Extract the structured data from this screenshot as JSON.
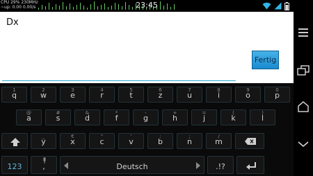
{
  "status_bar": {
    "cpu_line1": "CPU 29% 230MHz",
    "cpu_line2": "~up: 0.00 0.00/s",
    "time": "23:45"
  },
  "editor": {
    "text": "Dx"
  },
  "done_button": {
    "label": "Fertig"
  },
  "keyboard": {
    "row1": [
      {
        "main": "q",
        "hint": "1"
      },
      {
        "main": "w",
        "hint": "2"
      },
      {
        "main": "e",
        "hint": "3"
      },
      {
        "main": "r",
        "hint": "4"
      },
      {
        "main": "t",
        "hint": "5"
      },
      {
        "main": "z",
        "hint": "6"
      },
      {
        "main": "u",
        "hint": "7"
      },
      {
        "main": "i",
        "hint": "8"
      },
      {
        "main": "o",
        "hint": "9"
      },
      {
        "main": "p",
        "hint": "0"
      }
    ],
    "row2": [
      {
        "main": "a",
        "hint": "@"
      },
      {
        "main": "s",
        "hint": "#"
      },
      {
        "main": "d",
        "hint": "&"
      },
      {
        "main": "f",
        "hint": "*"
      },
      {
        "main": "g",
        "hint": "-"
      },
      {
        "main": "h",
        "hint": "+"
      },
      {
        "main": "j",
        "hint": "="
      },
      {
        "main": "k",
        "hint": "("
      },
      {
        "main": "l",
        "hint": ")"
      }
    ],
    "row3": [
      {
        "main": "y",
        "hint": "_"
      },
      {
        "main": "x",
        "hint": "€"
      },
      {
        "main": "c",
        "hint": "\""
      },
      {
        "main": "v",
        "hint": "'"
      },
      {
        "main": "b",
        "hint": ":"
      },
      {
        "main": "n",
        "hint": ";"
      },
      {
        "main": "m",
        "hint": "/"
      }
    ],
    "symbols_key": "123",
    "comma_key": ",",
    "space_key": "Deutsch",
    "punct_key": ".!?"
  },
  "icons": {
    "shift": "shift-icon",
    "backspace": "backspace-icon",
    "mic": "microphone-icon",
    "enter": "enter-icon",
    "menu": "menu-icon",
    "recent_apps": "recent-apps-icon",
    "home": "home-icon",
    "back": "back-icon"
  },
  "colors": {
    "accent": "#29a9d4",
    "button": "#2196d8"
  }
}
